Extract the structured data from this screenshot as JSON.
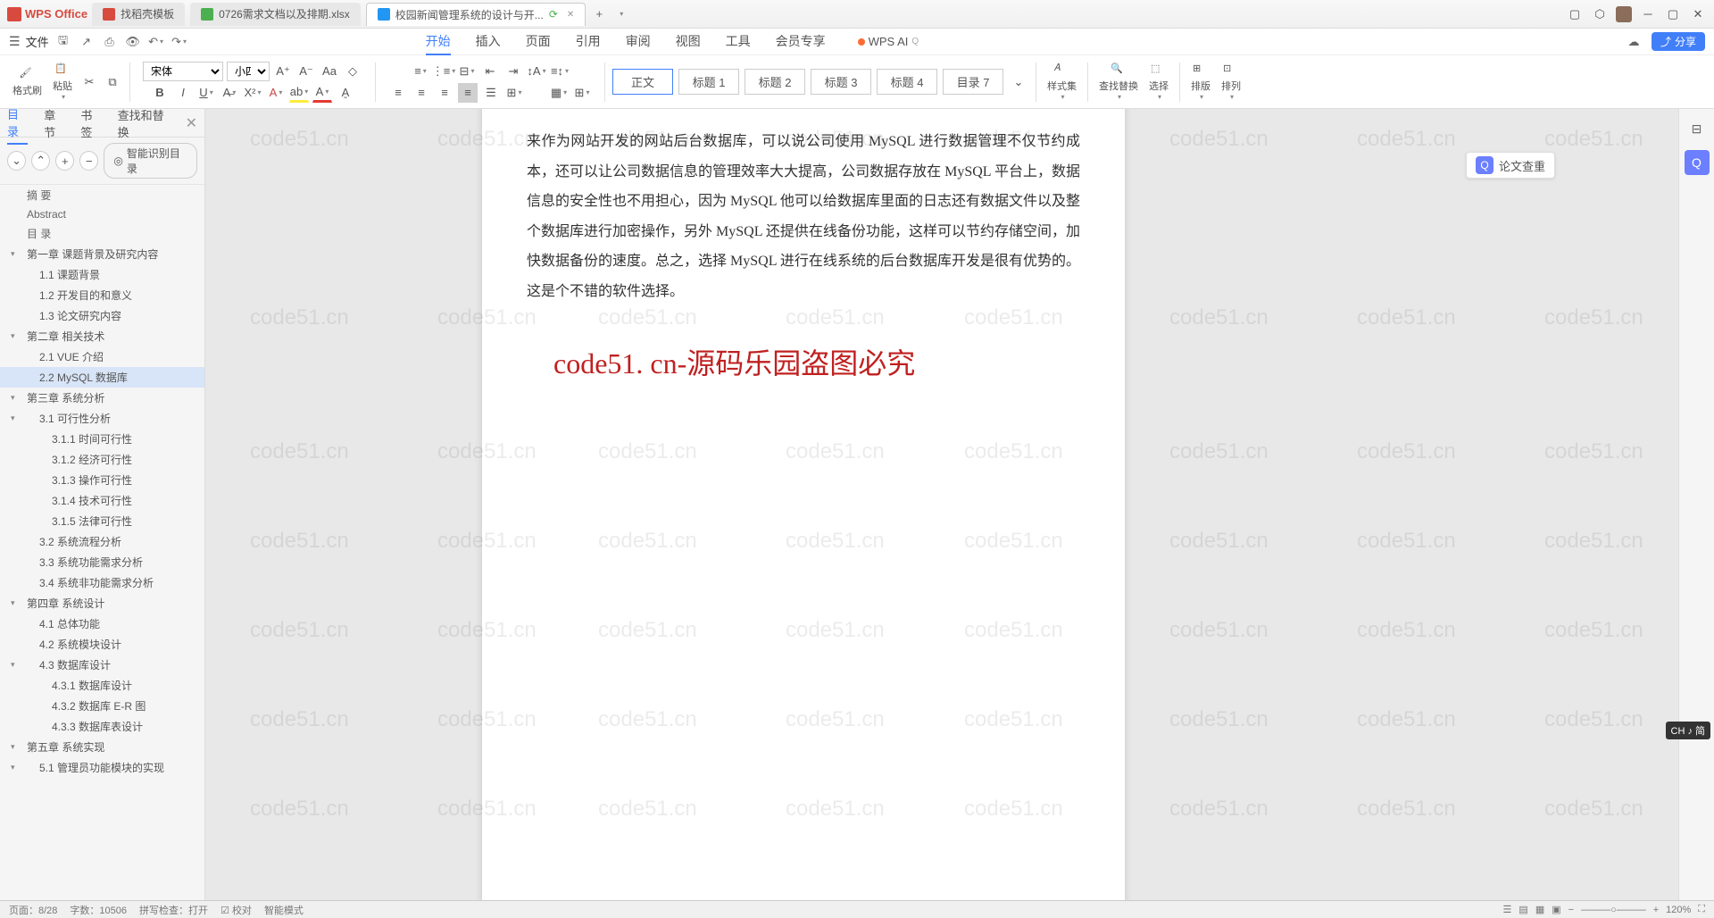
{
  "titlebar": {
    "app_name": "WPS Office",
    "tabs": [
      {
        "label": "找稻壳模板",
        "icon": "red"
      },
      {
        "label": "0726需求文档以及排期.xlsx",
        "icon": "green"
      },
      {
        "label": "校园新闻管理系统的设计与开...",
        "icon": "blue",
        "active": true
      }
    ],
    "new_tab": "+"
  },
  "menubar": {
    "file": "文件",
    "tabs": [
      "开始",
      "插入",
      "页面",
      "引用",
      "审阅",
      "视图",
      "工具",
      "会员专享"
    ],
    "active": "开始",
    "wps_ai": "WPS AI",
    "share": "分享"
  },
  "ribbon": {
    "format_painter": "格式刷",
    "paste": "粘贴",
    "font_name": "宋体",
    "font_size": "小四",
    "styles": [
      "正文",
      "标题 1",
      "标题 2",
      "标题 3",
      "标题 4",
      "目录 7"
    ],
    "styles_btn": "样式集",
    "find_replace": "查找替换",
    "select": "选择",
    "arrange": "排版",
    "align": "排列"
  },
  "sidebar": {
    "tabs": [
      "目录",
      "章节",
      "书签",
      "查找和替换"
    ],
    "active": "目录",
    "smart": "智能识别目录",
    "outline": [
      {
        "lvl": 0,
        "label": "摘    要"
      },
      {
        "lvl": 0,
        "label": "Abstract"
      },
      {
        "lvl": 0,
        "label": "目    录"
      },
      {
        "lvl": 1,
        "label": "第一章   课题背景及研究内容",
        "exp": true
      },
      {
        "lvl": 2,
        "label": "1.1  课题背景"
      },
      {
        "lvl": 2,
        "label": "1.2  开发目的和意义"
      },
      {
        "lvl": 2,
        "label": "1.3  论文研究内容"
      },
      {
        "lvl": 1,
        "label": "第二章 相关技术",
        "exp": true
      },
      {
        "lvl": 2,
        "label": "2.1 VUE 介绍"
      },
      {
        "lvl": 2,
        "label": "2.2 MySQL 数据库",
        "selected": true
      },
      {
        "lvl": 1,
        "label": "第三章 系统分析",
        "exp": true
      },
      {
        "lvl": 2,
        "label": "3.1 可行性分析",
        "exp": true
      },
      {
        "lvl": 3,
        "label": "3.1.1 时间可行性"
      },
      {
        "lvl": 3,
        "label": "3.1.2 经济可行性"
      },
      {
        "lvl": 3,
        "label": "3.1.3 操作可行性"
      },
      {
        "lvl": 3,
        "label": "3.1.4 技术可行性"
      },
      {
        "lvl": 3,
        "label": "3.1.5 法律可行性"
      },
      {
        "lvl": 2,
        "label": "3.2 系统流程分析"
      },
      {
        "lvl": 2,
        "label": "3.3 系统功能需求分析"
      },
      {
        "lvl": 2,
        "label": "3.4 系统非功能需求分析"
      },
      {
        "lvl": 1,
        "label": "第四章 系统设计",
        "exp": true
      },
      {
        "lvl": 2,
        "label": "4.1 总体功能"
      },
      {
        "lvl": 2,
        "label": "4.2 系统模块设计"
      },
      {
        "lvl": 2,
        "label": "4.3 数据库设计",
        "exp": true
      },
      {
        "lvl": 3,
        "label": "4.3.1 数据库设计"
      },
      {
        "lvl": 3,
        "label": "4.3.2 数据库 E-R 图"
      },
      {
        "lvl": 3,
        "label": "4.3.3 数据库表设计"
      },
      {
        "lvl": 1,
        "label": "第五章 系统实现",
        "exp": true
      },
      {
        "lvl": 2,
        "label": "5.1 管理员功能模块的实现",
        "exp": true
      }
    ]
  },
  "document": {
    "body": "来作为网站开发的网站后台数据库，可以说公司使用 MySQL 进行数据管理不仅节约成本，还可以让公司数据信息的管理效率大大提高，公司数据存放在 MySQL 平台上，数据信息的安全性也不用担心，因为 MySQL 他可以给数据库里面的日志还有数据文件以及整个数据库进行加密操作，另外 MySQL 还提供在线备份功能，这样可以节约存储空间，加快数据备份的速度。总之，选择 MySQL 进行在线系统的后台数据库开发是很有优势的。这是个不错的软件选择。",
    "watermark": "code51. cn-源码乐园盗图必究",
    "bg_watermark": "code51.cn"
  },
  "right_panel": {
    "paper_check": "论文查重"
  },
  "ime": "CH ♪ 简",
  "status": {
    "page": "页面：8/28",
    "words": "字数：10506",
    "spell": "拼写检查：打开",
    "proof": "校对",
    "mode": "智能模式",
    "zoom": "120%"
  }
}
